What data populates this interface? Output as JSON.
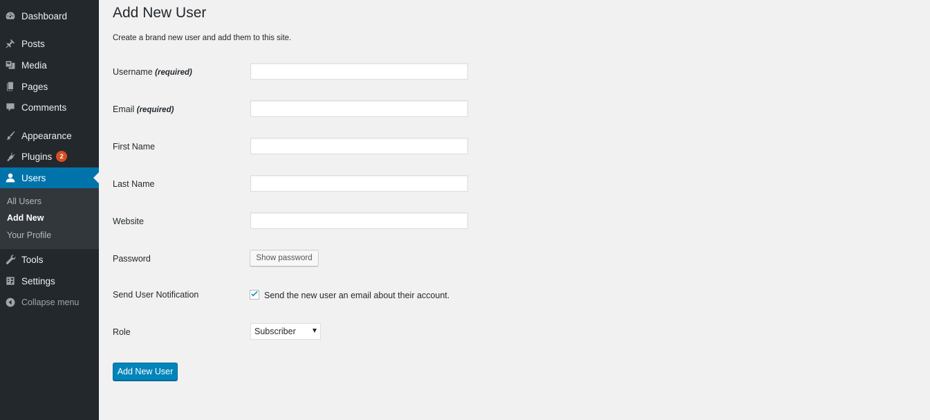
{
  "sidebar": {
    "menu": [
      {
        "label": "Dashboard",
        "icon": "dashboard-icon"
      },
      {
        "label": "Posts",
        "icon": "pin-icon"
      },
      {
        "label": "Media",
        "icon": "media-icon"
      },
      {
        "label": "Pages",
        "icon": "pages-icon"
      },
      {
        "label": "Comments",
        "icon": "comment-icon"
      },
      {
        "label": "Appearance",
        "icon": "brush-icon"
      },
      {
        "label": "Plugins",
        "icon": "plugin-icon",
        "badge": "2"
      },
      {
        "label": "Users",
        "icon": "user-icon",
        "current": true
      },
      {
        "label": "Tools",
        "icon": "wrench-icon"
      },
      {
        "label": "Settings",
        "icon": "settings-icon"
      },
      {
        "label": "Collapse menu",
        "icon": "collapse-icon"
      }
    ],
    "users_submenu": [
      {
        "label": "All Users"
      },
      {
        "label": "Add New",
        "active": true
      },
      {
        "label": "Your Profile"
      }
    ]
  },
  "main": {
    "title": "Add New User",
    "description": "Create a brand new user and add them to this site.",
    "fields": {
      "username": {
        "label": "Username",
        "required_text": "(required)",
        "value": ""
      },
      "email": {
        "label": "Email",
        "required_text": "(required)",
        "value": ""
      },
      "first_name": {
        "label": "First Name",
        "value": ""
      },
      "last_name": {
        "label": "Last Name",
        "value": ""
      },
      "website": {
        "label": "Website",
        "value": ""
      },
      "password": {
        "label": "Password",
        "button_label": "Show password"
      },
      "notification": {
        "label": "Send User Notification",
        "checkbox_label": "Send the new user an email about their account.",
        "checked": true
      },
      "role": {
        "label": "Role",
        "selected": "Subscriber"
      }
    },
    "submit_label": "Add New User"
  },
  "colors": {
    "sidebar_bg": "#23282d",
    "submenu_bg": "#32373c",
    "accent": "#0073aa",
    "primary_button": "#0085ba",
    "badge": "#d54e21",
    "page_bg": "#f1f1f1"
  }
}
